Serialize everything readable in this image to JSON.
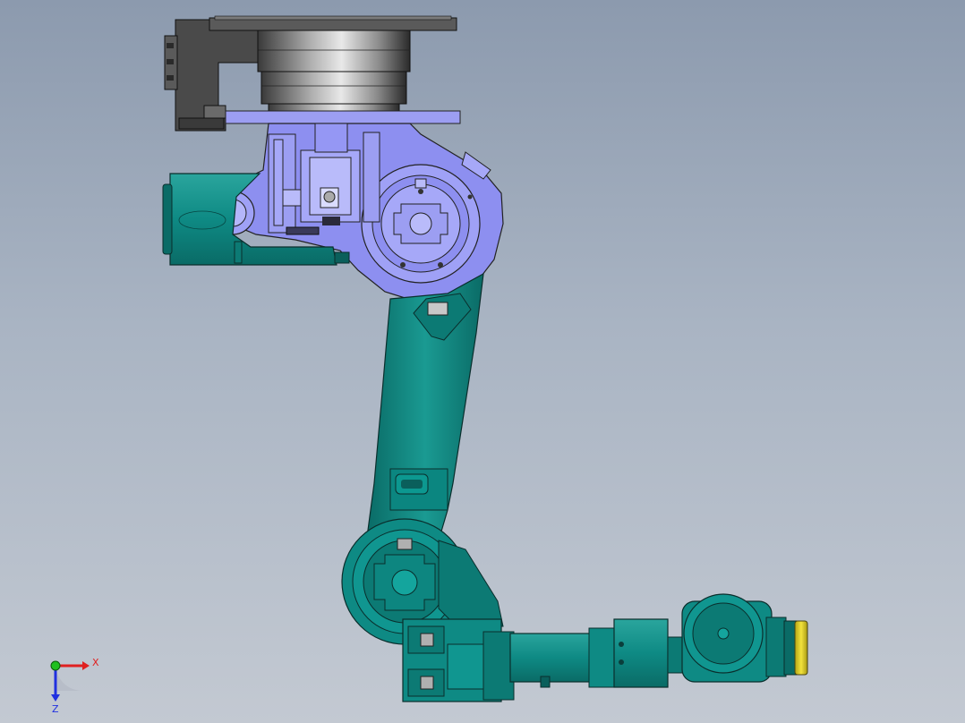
{
  "viewport": {
    "background_top": "#8c9aae",
    "background_bottom": "#c3c9d2"
  },
  "colors": {
    "teal": "#0e8a84",
    "teal_dark": "#0a5f5b",
    "teal_light": "#3fb3ab",
    "purple": "#8d8ff0",
    "purple_light": "#b9bbfa",
    "gray_dark": "#404040",
    "gray_mid": "#8a8a8a",
    "yellow": "#e6d62a"
  },
  "triad": {
    "x_label": "X",
    "z_label": "Z",
    "x_color": "#e02020",
    "z_color": "#2030e0",
    "origin_color": "#20c020"
  }
}
